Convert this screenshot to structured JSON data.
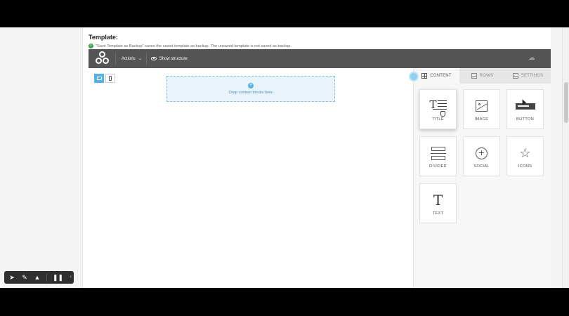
{
  "template": {
    "title": "Template:",
    "note": "\"Save Template as Backup\" saves the saved template as backup. The unsaved template is not saved as backup.",
    "info_icon": "info-icon"
  },
  "toolbar": {
    "actions_label": "Actions",
    "show_structure_label": "Show structure",
    "logo_icon": "logo-circles-icon",
    "cloud_icon": "cloud-upload-icon"
  },
  "canvas": {
    "drop_label": "Drop content blocks here",
    "devices": [
      "desktop",
      "mobile"
    ],
    "active_device": "desktop"
  },
  "panel": {
    "tabs": [
      {
        "label": "CONTENT",
        "active": true
      },
      {
        "label": "ROWS",
        "active": false
      },
      {
        "label": "SETTINGS",
        "active": false
      }
    ],
    "blocks": [
      {
        "label": "TITLE",
        "icon": "title-icon"
      },
      {
        "label": "IMAGE",
        "icon": "image-icon"
      },
      {
        "label": "BUTTON",
        "icon": "button-icon"
      },
      {
        "label": "DIVIDER",
        "icon": "divider-icon"
      },
      {
        "label": "SOCIAL",
        "icon": "social-icon"
      },
      {
        "label": "ICONS",
        "icon": "star-icon"
      },
      {
        "label": "TEXT",
        "icon": "text-icon"
      }
    ]
  },
  "colors": {
    "accent": "#56b1e4",
    "toolbar_bg": "#555555",
    "drop_bg": "#e8f3fa"
  },
  "glyphs": {
    "chevron": "⌄",
    "plus": "+",
    "cloud": "☁",
    "title_T": "T",
    "text_T": "T",
    "social_plus": "+",
    "star": "☆",
    "pointer": "➤",
    "pen": "✎",
    "highlighter": "▲",
    "pause": "❚❚",
    "collapse": "‹"
  }
}
